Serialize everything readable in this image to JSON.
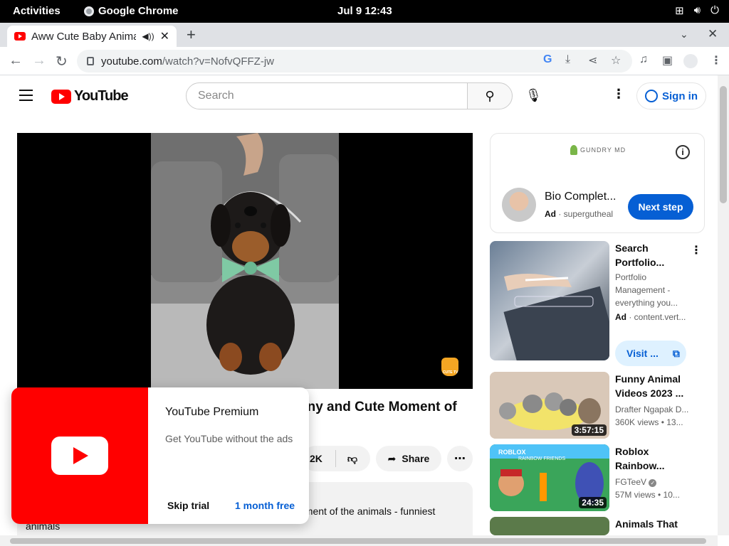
{
  "system_bar": {
    "activities": "Activities",
    "app_name": "Google Chrome",
    "clock": "Jul 9  12:43"
  },
  "browser": {
    "tab_title": "Aww Cute Baby Animals",
    "url_domain": "youtube.com",
    "url_path": "/watch?v=NofvQFFZ-jw"
  },
  "youtube": {
    "logo_text": "YouTube",
    "search_placeholder": "Search",
    "sign_in": "Sign in"
  },
  "video": {
    "title_visible": "nny and Cute Moment of",
    "like_count": "2K",
    "share_label": "Share",
    "description_line1": "oment of the animals - funniest",
    "description_line2": "animals"
  },
  "ad_card": {
    "brand": "GUNDRY MD",
    "title": "Bio Complet...",
    "ad_label": "Ad",
    "advertiser": "supergutheal",
    "cta": "Next step"
  },
  "sidebar": {
    "items": [
      {
        "title_line1": "Search",
        "title_line2": "Portfolio...",
        "meta1": "Portfolio",
        "meta2": "Management -",
        "meta3": "everything you...",
        "ad_label": "Ad",
        "ad_source": "content.vert...",
        "visit": "Visit ..."
      },
      {
        "title_line1": "Funny Animal",
        "title_line2": "Videos 2023 ...",
        "channel": "Drafter Ngapak D...",
        "stats": "360K views  • 13...",
        "duration": "3:57:15"
      },
      {
        "title_line1": "Roblox",
        "title_line2": "Rainbow...",
        "channel": "FGTeeV",
        "stats": "57M views  • 10...",
        "duration": "24:35"
      },
      {
        "title_line1": "Animals That",
        "title_line2": ""
      }
    ]
  },
  "premium_popup": {
    "title": "YouTube Premium",
    "subtitle": "Get YouTube without the ads",
    "skip": "Skip trial",
    "cta": "1 month free"
  }
}
